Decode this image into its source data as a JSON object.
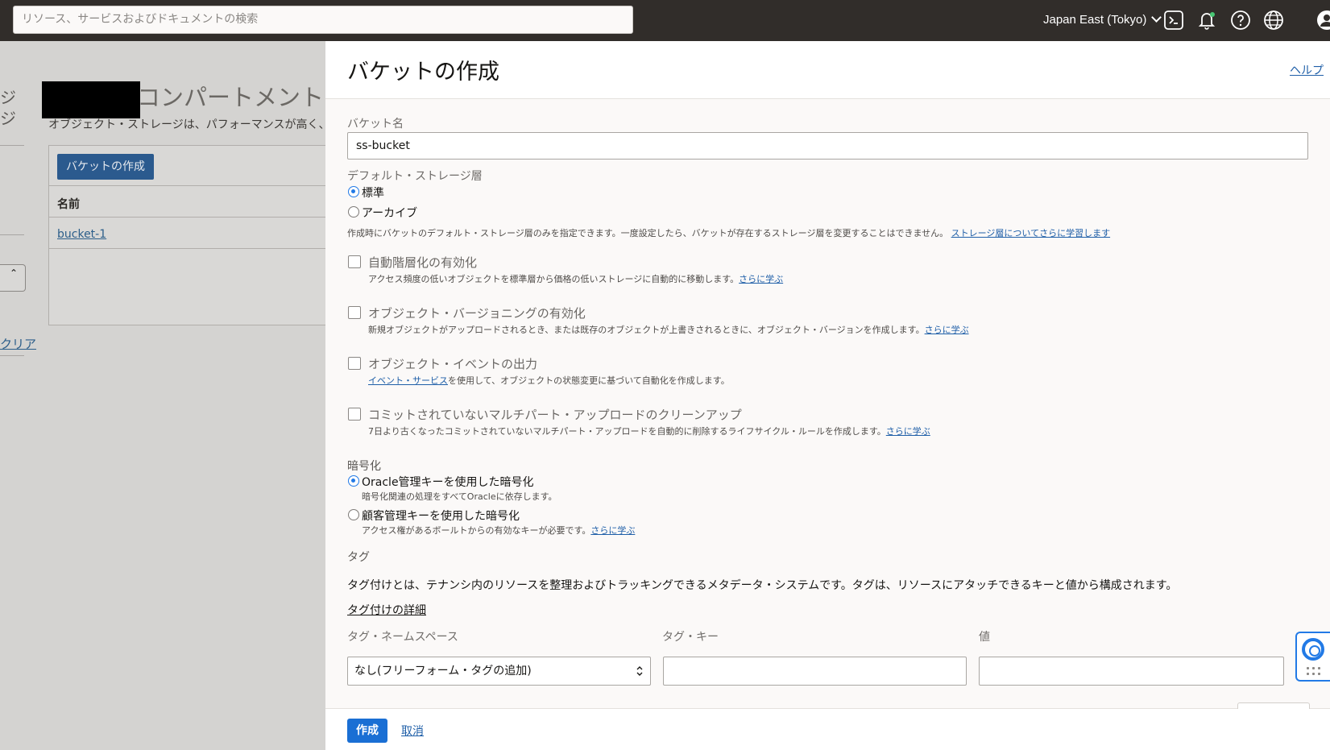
{
  "header": {
    "search_placeholder": "リソース、サービスおよびドキュメントの検索",
    "region": "Japan East (Tokyo)",
    "icons": [
      "cloud-shell-icon",
      "bell-icon",
      "help-icon",
      "globe-icon",
      "user-icon"
    ]
  },
  "background_page": {
    "left_text_1": "ジ",
    "left_text_2": "ジ",
    "clear_link": "クリア",
    "title": "コンパートメント内",
    "description": "オブジェクト・ストレージは、パフォーマンスが高く、",
    "create_button": "バケットの作成",
    "column_name": "名前",
    "row_link": "bucket-1"
  },
  "panel": {
    "title": "バケットの作成",
    "help_link": "ヘルプ",
    "bucket_name_label": "バケット名",
    "bucket_name_value": "ss-bucket",
    "storage_tier_label": "デフォルト・ストレージ層",
    "tier_standard": "標準",
    "tier_archive": "アーカイブ",
    "tier_note": "作成時にバケットのデフォルト・ストレージ層のみを指定できます。一度設定したら、バケットが存在するストレージ層を変更することはできません。",
    "tier_note_link": "ストレージ層についてさらに学習します",
    "auto_tiering": {
      "label": "自動階層化の有効化",
      "desc": "アクセス頻度の低いオブジェクトを標準層から価格の低いストレージに自動的に移動します。",
      "link": "さらに学ぶ"
    },
    "versioning": {
      "label": "オブジェクト・バージョニングの有効化",
      "desc": "新規オブジェクトがアップロードされるとき、または既存のオブジェクトが上書きされるときに、オブジェクト・バージョンを作成します。",
      "link": "さらに学ぶ"
    },
    "events": {
      "label": "オブジェクト・イベントの出力",
      "link": "イベント・サービス",
      "desc": "を使用して、オブジェクトの状態変更に基づいて自動化を作成します。"
    },
    "multipart": {
      "label": "コミットされていないマルチパート・アップロードのクリーンアップ",
      "desc": "7日より古くなったコミットされていないマルチパート・アップロードを自動的に削除するライフサイクル・ルールを作成します。",
      "link": "さらに学ぶ"
    },
    "encryption_label": "暗号化",
    "enc_oracle": "Oracle管理キーを使用した暗号化",
    "enc_oracle_desc": "暗号化関連の処理をすべてOracleに依存します。",
    "enc_customer": "顧客管理キーを使用した暗号化",
    "enc_customer_desc": "アクセス権があるボールトからの有効なキーが必要です。",
    "enc_customer_link": "さらに学ぶ",
    "tags_label": "タグ",
    "tags_desc": "タグ付けとは、テナンシ内のリソースを整理およびトラッキングできるメタデータ・システムです。タグは、リソースにアタッチできるキーと値から構成されます。",
    "tags_link": "タグ付けの詳細",
    "tag_namespace_label": "タグ・ネームスペース",
    "tag_key_label": "タグ・キー",
    "tag_value_label": "値",
    "tag_namespace_value": "なし(フリーフォーム・タグの追加)",
    "create_button": "作成",
    "cancel_link": "取消"
  },
  "colors": {
    "header_bg": "#312d2a",
    "primary": "#1a6fd4",
    "link": "#1f5fa8"
  }
}
